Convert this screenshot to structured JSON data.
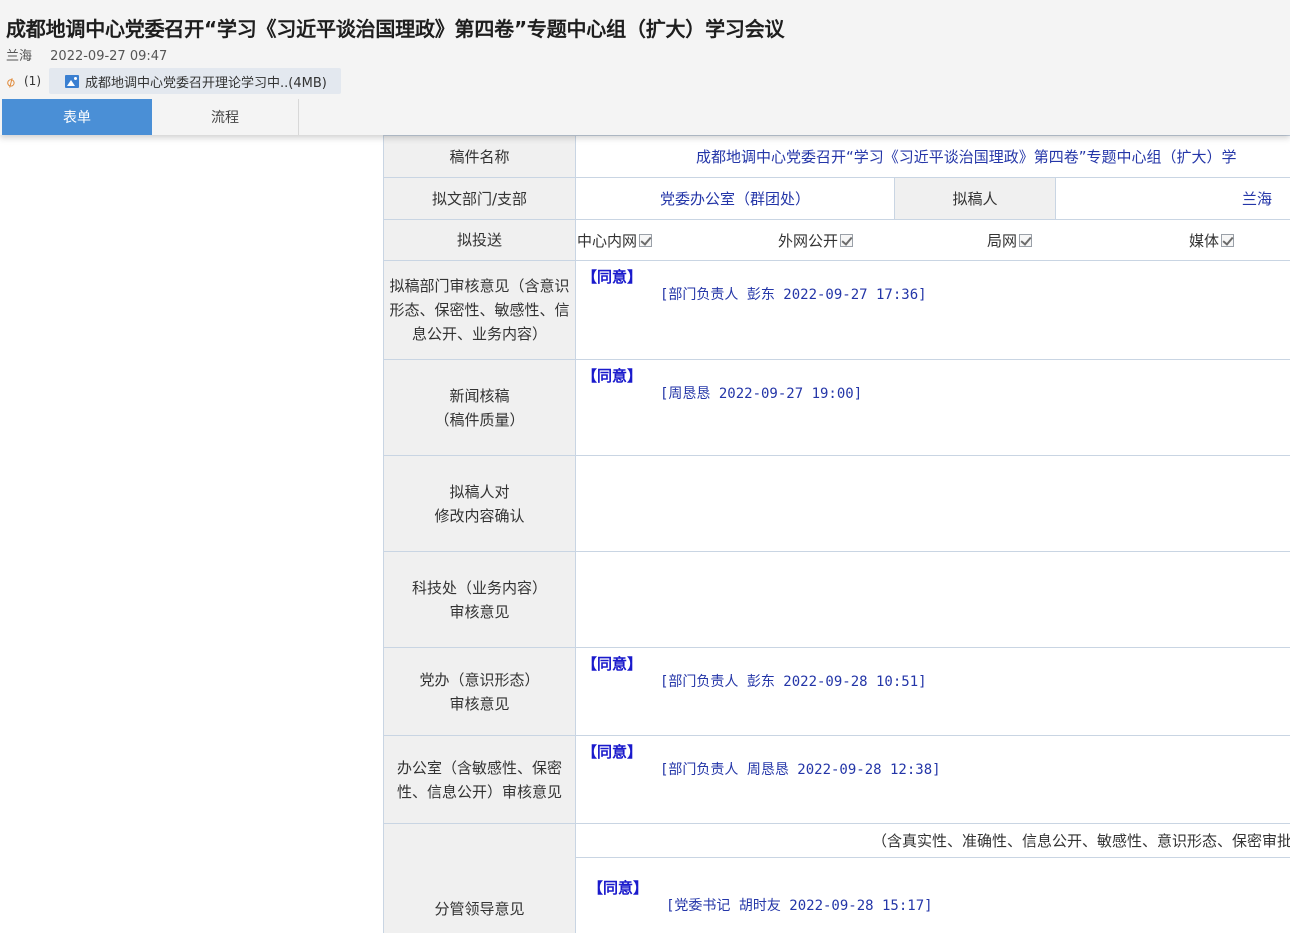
{
  "header": {
    "title": "成都地调中心党委召开“学习《习近平谈治国理政》第四卷”专题中心组（扩大）学习会议",
    "author": "兰海",
    "datetime": "2022-09-27 09:47",
    "attachment_count": "(1)",
    "attachment_name": "成都地调中心党委召开理论学习中..(4MB)"
  },
  "tabs": [
    {
      "label": "表单",
      "active": true
    },
    {
      "label": "流程",
      "active": false
    }
  ],
  "form": {
    "title_label": "稿件名称",
    "title_value": "成都地调中心党委召开“学习《习近平谈治国理政》第四卷”专题中心组（扩大）学",
    "dept_label": "拟文部门/支部",
    "dept_value": "党委办公室（群团处）",
    "drafter_label": "拟稿人",
    "drafter_value": "兰海",
    "send_label": "拟投送",
    "send_options": [
      "中心内网",
      "外网公开",
      "局网",
      "媒体"
    ],
    "review1": {
      "label": "拟稿部门审核意见（含意识形态、保密性、敏感性、信息公开、业务内容）",
      "agree": "【同意】",
      "sign": "[部门负责人 彭东 2022-09-27 17:36]"
    },
    "review2": {
      "label_line1": "新闻核稿",
      "label_line2": "（稿件质量）",
      "agree": "【同意】",
      "sign": "[周恳恳 2022-09-27 19:00]"
    },
    "review3": {
      "label_line1": "拟稿人对",
      "label_line2": "修改内容确认"
    },
    "review4": {
      "label_line1": "科技处（业务内容）",
      "label_line2": "审核意见"
    },
    "review5": {
      "label_line1": "党办（意识形态）",
      "label_line2": "审核意见",
      "agree": "【同意】",
      "sign": "[部门负责人 彭东 2022-09-28 10:51]"
    },
    "review6": {
      "label": "办公室（含敏感性、保密性、信息公开）审核意见",
      "agree": "【同意】",
      "sign": "[部门负责人 周恳恳 2022-09-28 12:38]"
    },
    "review7": {
      "label": "分管领导意见",
      "note": "（含真实性、准确性、信息公开、敏感性、意识形态、保密审批）",
      "agree": "【同意】",
      "sign": "[党委书记 胡时友 2022-09-28 15:17]"
    }
  }
}
